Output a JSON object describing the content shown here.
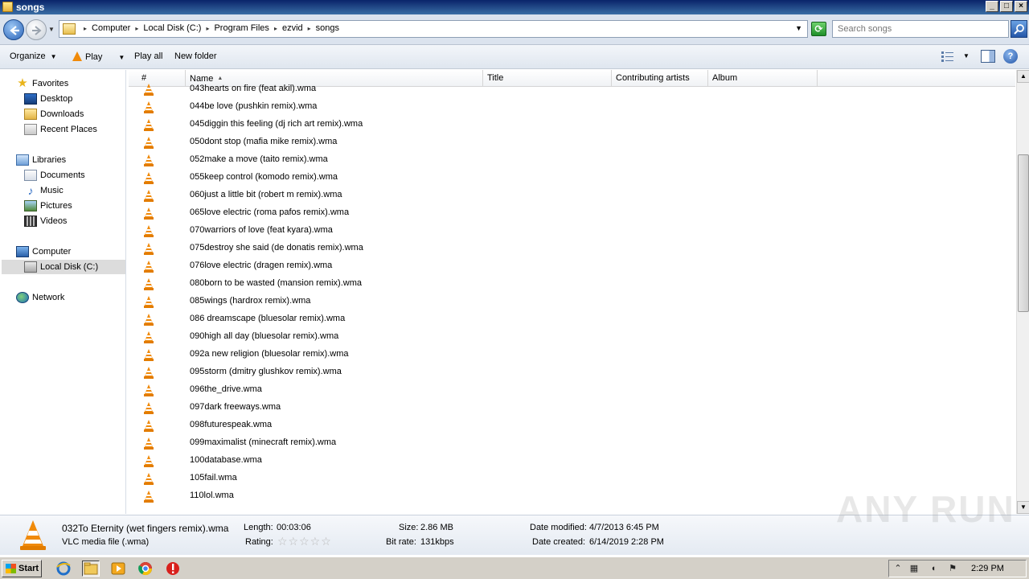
{
  "window": {
    "title": "songs",
    "buttons": [
      "_",
      "□",
      "×"
    ]
  },
  "address": {
    "breadcrumbs": [
      "Computer",
      "Local Disk (C:)",
      "Program Files",
      "ezvid",
      "songs"
    ],
    "search_placeholder": "Search songs"
  },
  "toolbar": {
    "organize": "Organize",
    "play": "Play",
    "play_all": "Play all",
    "new_folder": "New folder",
    "help": "?"
  },
  "navpane": {
    "favorites": "Favorites",
    "desktop": "Desktop",
    "downloads": "Downloads",
    "recent_places": "Recent Places",
    "libraries": "Libraries",
    "documents": "Documents",
    "music": "Music",
    "pictures": "Pictures",
    "videos": "Videos",
    "computer": "Computer",
    "local_disk": "Local Disk (C:)",
    "network": "Network"
  },
  "columns": {
    "number": "#",
    "name": "Name",
    "title": "Title",
    "contributing_artists": "Contributing artists",
    "album": "Album"
  },
  "files": [
    "043hearts on fire (feat akil).wma",
    "044be love (pushkin remix).wma",
    "045diggin this feeling (dj rich art remix).wma",
    "050dont stop (mafia mike remix).wma",
    "052make a move (taito remix).wma",
    "055keep control (komodo remix).wma",
    "060just a little bit (robert m remix).wma",
    "065love electric (roma pafos remix).wma",
    "070warriors of love (feat kyara).wma",
    "075destroy she said (de donatis remix).wma",
    "076love electric (dragen remix).wma",
    "080born to be wasted (mansion remix).wma",
    "085wings (hardrox remix).wma",
    "086 dreamscape (bluesolar remix).wma",
    "090high all day (bluesolar remix).wma",
    "092a new religion (bluesolar remix).wma",
    "095storm (dmitry glushkov remix).wma",
    "096the_drive.wma",
    "097dark freeways.wma",
    "098futurespeak.wma",
    "099maximalist (minecraft remix).wma",
    "100database.wma",
    "105fail.wma",
    "110lol.wma"
  ],
  "details": {
    "filename": "032To Eternity (wet fingers remix).wma",
    "filetype": "VLC media file (.wma)",
    "length_label": "Length:",
    "length": "00:03:06",
    "rating_label": "Rating:",
    "size_label": "Size:",
    "size": "2.86 MB",
    "bitrate_label": "Bit rate:",
    "bitrate": "131kbps",
    "modified_label": "Date modified:",
    "modified": "4/7/2013 6:45 PM",
    "created_label": "Date created:",
    "created": "6/14/2019 2:28 PM"
  },
  "taskbar": {
    "start": "Start",
    "clock": "2:29 PM"
  },
  "watermark": "ANY RUN",
  "colors": {
    "vlc_orange": "#f08a0a",
    "selection_gray": "#dcdcdc"
  }
}
